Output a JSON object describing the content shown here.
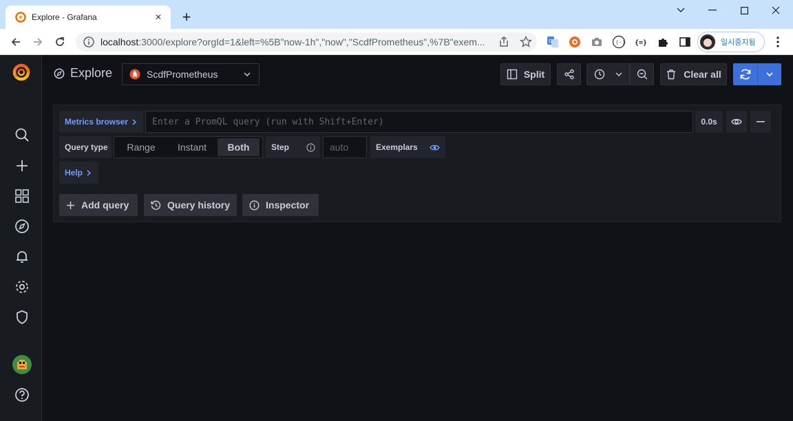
{
  "browser": {
    "tab": {
      "title": "Explore - Grafana",
      "close_glyph": "✕"
    },
    "new_tab_glyph": "+",
    "url": {
      "host": "localhost",
      "rest": ":3000/explore?orgId=1&left=%5B\"now-1h\",\"now\",\"ScdfPrometheus\",%7B\"exem..."
    },
    "profile": {
      "name": "일시중지됨"
    },
    "colors": {
      "titlebar": "#c9e2fb",
      "toolbar": "#ffffff"
    }
  },
  "sidemenu": {
    "items": [
      {
        "name": "search-icon"
      },
      {
        "name": "plus-icon"
      },
      {
        "name": "dashboards-icon"
      },
      {
        "name": "explore-icon"
      },
      {
        "name": "alerting-icon"
      },
      {
        "name": "configuration-icon"
      },
      {
        "name": "server-admin-icon"
      },
      {
        "name": "user-avatar"
      },
      {
        "name": "help-icon"
      }
    ]
  },
  "header": {
    "title": "Explore",
    "datasource": "ScdfPrometheus",
    "split_label": "Split",
    "clear_all_label": "Clear all"
  },
  "query": {
    "metrics_browser_label": "Metrics browser",
    "placeholder": "Enter a PromQL query (run with Shift+Enter)",
    "duration": "0.0s",
    "query_type_label": "Query type",
    "query_type_options": [
      "Range",
      "Instant",
      "Both"
    ],
    "query_type_selected": "Both",
    "step_label": "Step",
    "step_placeholder": "auto",
    "exemplars_label": "Exemplars",
    "help_label": "Help"
  },
  "actions": {
    "add_query": "Add query",
    "query_history": "Query history",
    "inspector": "Inspector"
  },
  "colors": {
    "accent_blue": "#3d71d9",
    "link_blue": "#6e9fff",
    "background": "#111217",
    "panel": "#181b1f"
  }
}
